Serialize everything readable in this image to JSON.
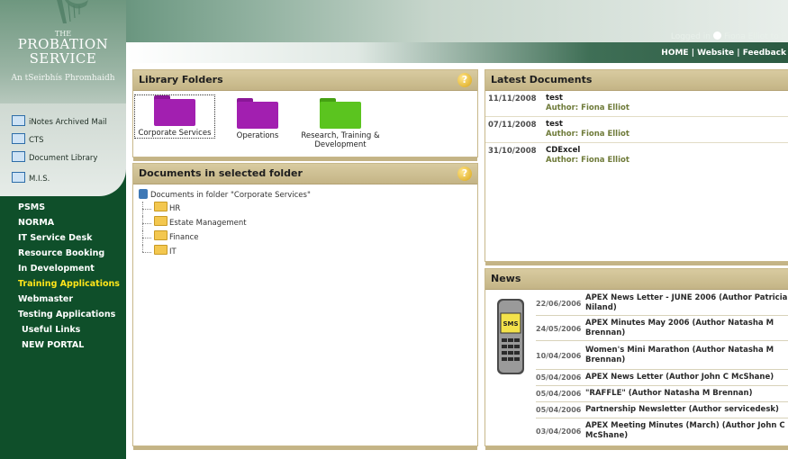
{
  "brand": {
    "the": "THE",
    "name_line1": "PROBATION",
    "name_line2": "SERVICE",
    "irish": "An tSeirbhís Phromhaidh"
  },
  "header": {
    "logged_in_label": "Logged in",
    "logged_in_user": "Fiona Elliot to P",
    "links": [
      "HOME",
      "Website",
      "Feedback"
    ]
  },
  "sidebar": {
    "tools": [
      {
        "label": "iNotes  Archived Mail",
        "icon": "mail-icon"
      },
      {
        "label": "CTS",
        "icon": "cts-icon"
      },
      {
        "label": "Document Library",
        "icon": "library-icon"
      },
      {
        "label": "M.I.S.",
        "icon": "mis-icon"
      }
    ],
    "menu": [
      {
        "label": "PSMS"
      },
      {
        "label": "NORMA"
      },
      {
        "label": "IT Service Desk"
      },
      {
        "label": "Resource Booking"
      },
      {
        "label": "In Development"
      },
      {
        "label": "Training Applications"
      },
      {
        "label": "Webmaster"
      },
      {
        "label": "Testing Applications"
      },
      {
        "label": "Useful Links"
      },
      {
        "label": "NEW PORTAL"
      }
    ]
  },
  "library": {
    "title": "Library Folders",
    "help": "?",
    "folders": [
      {
        "label": "Corporate Services",
        "color": "#a21fb0"
      },
      {
        "label": "Operations",
        "color": "#a21fb0"
      },
      {
        "label": "Research, Training & Development",
        "color": "#5bc41f"
      }
    ]
  },
  "documents": {
    "title": "Documents in selected folder",
    "help": "?",
    "root": "Documents in folder \"Corporate Services\"",
    "folders": [
      "HR",
      "Estate Management",
      "Finance",
      "IT"
    ]
  },
  "latest": {
    "title": "Latest Documents",
    "items": [
      {
        "date": "11/11/2008",
        "title": "test",
        "author": "Author: Fiona Elliot"
      },
      {
        "date": "07/11/2008",
        "title": "test",
        "author": "Author: Fiona Elliot"
      },
      {
        "date": "31/10/2008",
        "title": "CDExcel",
        "author": "Author: Fiona Elliot"
      }
    ]
  },
  "news": {
    "title": "News",
    "phone_label": "SMS",
    "items": [
      {
        "date": "22/06/2006",
        "text": "APEX News Letter - JUNE 2006 (Author Patricia Niland)"
      },
      {
        "date": "24/05/2006",
        "text": "APEX Minutes May 2006 (Author Natasha M Brennan)"
      },
      {
        "date": "10/04/2006",
        "text": "Women's Mini Marathon (Author Natasha M Brennan)"
      },
      {
        "date": "05/04/2006",
        "text": "APEX News Letter (Author John C McShane)"
      },
      {
        "date": "05/04/2006",
        "text": "\"RAFFLE\" (Author Natasha M Brennan)"
      },
      {
        "date": "05/04/2006",
        "text": "Partnership Newsletter (Author servicedesk)"
      },
      {
        "date": "03/04/2006",
        "text": "APEX Meeting Minutes (March) (Author John C McShane)"
      }
    ]
  }
}
